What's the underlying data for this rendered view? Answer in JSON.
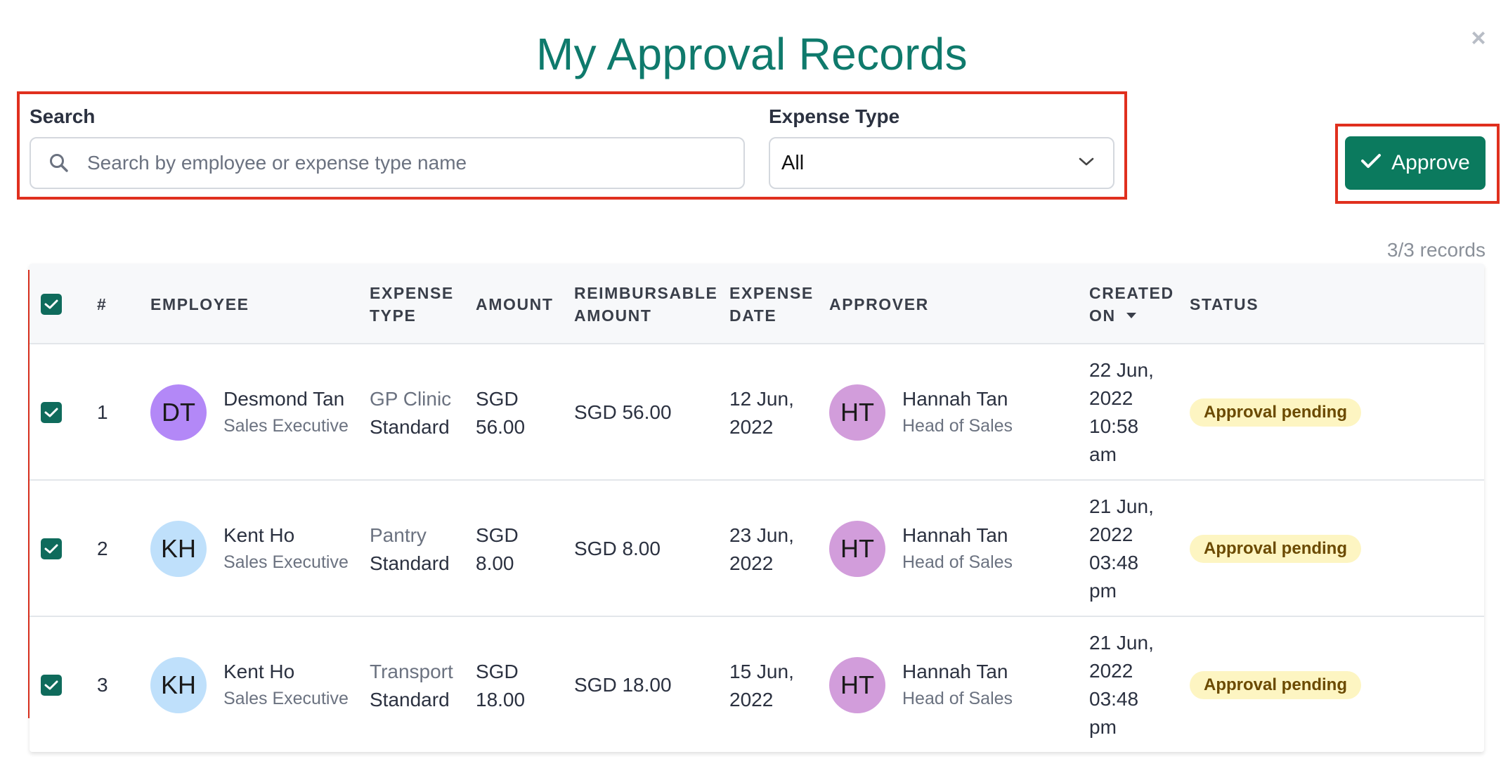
{
  "title": "My Approval Records",
  "close_glyph": "×",
  "filters": {
    "search_label": "Search",
    "search_placeholder": "Search by employee or expense type name",
    "search_value": "",
    "expense_type_label": "Expense Type",
    "expense_type_value": "All"
  },
  "approve_button": {
    "label": "Approve",
    "icon": "check-icon"
  },
  "records_count": "3/3 records",
  "table": {
    "headers": {
      "index": "#",
      "employee": "EMPLOYEE",
      "expense_type_1": "EXPENSE",
      "expense_type_2": "TYPE",
      "amount": "AMOUNT",
      "reimbursable_1": "REIMBURSABLE",
      "reimbursable_2": "AMOUNT",
      "expense_date_1": "EXPENSE",
      "expense_date_2": "DATE",
      "approver": "APPROVER",
      "created_on_1": "CREATED",
      "created_on_2": "ON",
      "status": "STATUS"
    },
    "select_all_checked": true,
    "rows": [
      {
        "checked": true,
        "index": "1",
        "employee": {
          "initials": "DT",
          "name": "Desmond Tan",
          "role": "Sales Executive",
          "avatar_color": "#b388f7"
        },
        "expense_type": {
          "category": "GP Clinic",
          "plan": "Standard"
        },
        "amount": {
          "currency": "SGD",
          "value": "56.00"
        },
        "reimbursable": "SGD 56.00",
        "expense_date": {
          "day_month": "12 Jun,",
          "year": "2022"
        },
        "approver": {
          "initials": "HT",
          "name": "Hannah Tan",
          "role": "Head of Sales",
          "avatar_color": "#d29ddb"
        },
        "created_on": [
          "22 Jun,",
          "2022",
          "10:58",
          "am"
        ],
        "status": "Approval pending"
      },
      {
        "checked": true,
        "index": "2",
        "employee": {
          "initials": "KH",
          "name": "Kent Ho",
          "role": "Sales Executive",
          "avatar_color": "#bfe0fb"
        },
        "expense_type": {
          "category": "Pantry",
          "plan": "Standard"
        },
        "amount": {
          "currency": "SGD",
          "value": "8.00"
        },
        "reimbursable": "SGD 8.00",
        "expense_date": {
          "day_month": "23 Jun,",
          "year": "2022"
        },
        "approver": {
          "initials": "HT",
          "name": "Hannah Tan",
          "role": "Head of Sales",
          "avatar_color": "#d29ddb"
        },
        "created_on": [
          "21 Jun,",
          "2022",
          "03:48",
          "pm"
        ],
        "status": "Approval pending"
      },
      {
        "checked": true,
        "index": "3",
        "employee": {
          "initials": "KH",
          "name": "Kent Ho",
          "role": "Sales Executive",
          "avatar_color": "#bfe0fb"
        },
        "expense_type": {
          "category": "Transport",
          "plan": "Standard"
        },
        "amount": {
          "currency": "SGD",
          "value": "18.00"
        },
        "reimbursable": "SGD 18.00",
        "expense_date": {
          "day_month": "15 Jun,",
          "year": "2022"
        },
        "approver": {
          "initials": "HT",
          "name": "Hannah Tan",
          "role": "Head of Sales",
          "avatar_color": "#d29ddb"
        },
        "created_on": [
          "21 Jun,",
          "2022",
          "03:48",
          "pm"
        ],
        "status": "Approval pending"
      }
    ]
  },
  "colors": {
    "title": "#0f7a6c",
    "approve_button": "#0b7a5e",
    "checkbox": "#0f6b5c",
    "highlight_box": "#e0301e",
    "status_badge_bg": "#fdf5c2",
    "status_badge_text": "#6b4a00"
  }
}
